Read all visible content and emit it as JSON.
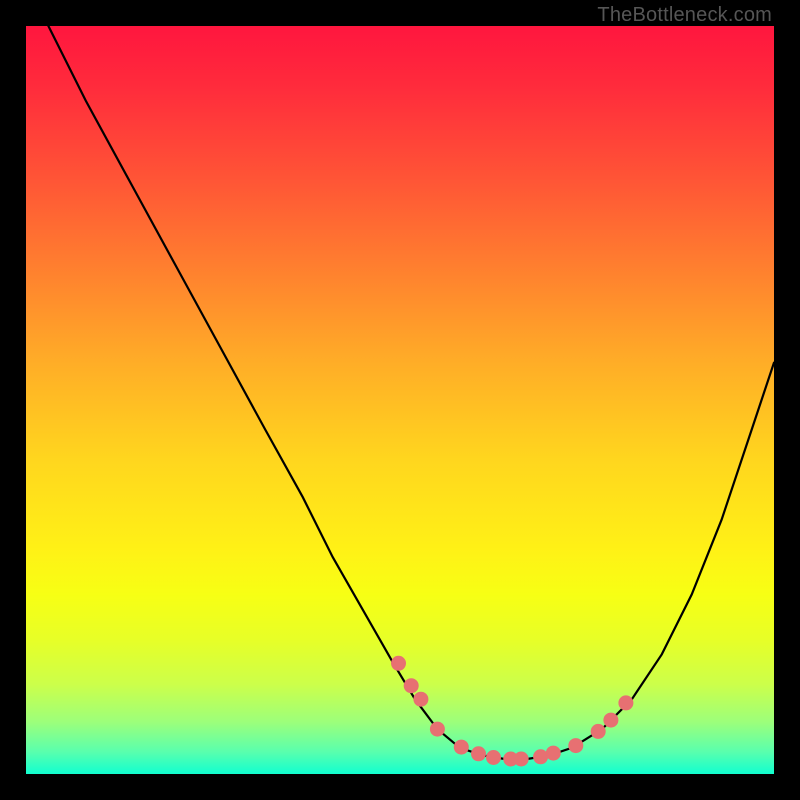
{
  "attribution": "TheBottleneck.com",
  "colors": {
    "page_bg": "#000000",
    "curve_stroke": "#000000",
    "dot_fill": "#e77072",
    "gradient_top": "#ff163e",
    "gradient_bottom": "#11ffd0"
  },
  "chart_data": {
    "type": "line",
    "title": "",
    "xlabel": "",
    "ylabel": "",
    "xlim": [
      0,
      100
    ],
    "ylim": [
      0,
      100
    ],
    "series": [
      {
        "name": "bottleneck-curve",
        "x": [
          3,
          8,
          14,
          20,
          26,
          32,
          37,
          41,
          45,
          49,
          52,
          55,
          58,
          61,
          64,
          67,
          70,
          73,
          77,
          81,
          85,
          89,
          93,
          97,
          100
        ],
        "y": [
          100,
          90,
          79,
          68,
          57,
          46,
          37,
          29,
          22,
          15,
          10,
          6,
          3.5,
          2.5,
          2.0,
          2.0,
          2.5,
          3.5,
          6,
          10,
          16,
          24,
          34,
          46,
          55
        ]
      }
    ],
    "dots": {
      "name": "highlighted-points",
      "x": [
        49.8,
        51.5,
        52.8,
        55.0,
        58.2,
        60.5,
        62.5,
        64.8,
        66.2,
        68.8,
        70.5,
        73.5,
        76.5,
        78.2,
        80.2
      ],
      "y": [
        14.8,
        11.8,
        10.0,
        6.0,
        3.6,
        2.7,
        2.2,
        2.0,
        2.0,
        2.3,
        2.8,
        3.8,
        5.7,
        7.2,
        9.5
      ]
    }
  }
}
